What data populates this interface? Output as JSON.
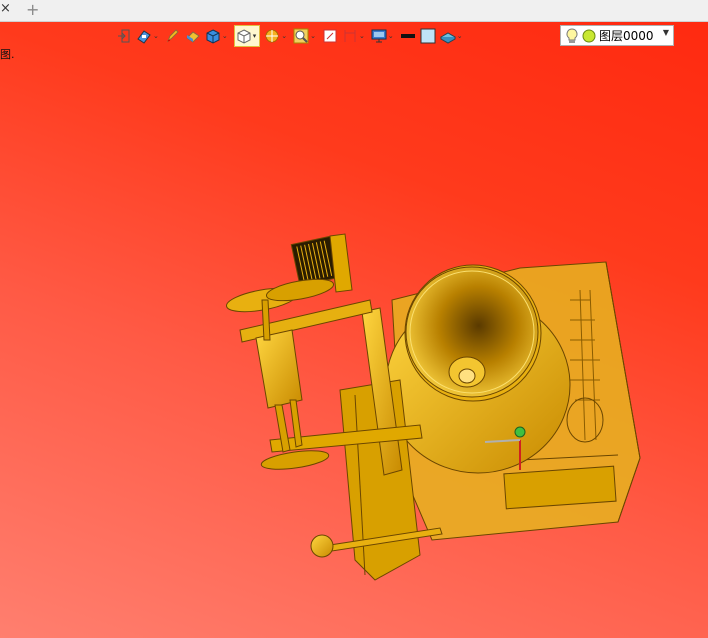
{
  "tabbar": {
    "close_glyph": "×",
    "add_glyph": "+"
  },
  "status_fragment": "图.",
  "toolbar": {
    "items": [
      {
        "icon": "exit-icon",
        "caret": false
      },
      {
        "icon": "view-orientation-icon",
        "caret": true
      },
      {
        "icon": "pen-icon",
        "caret": false
      },
      {
        "icon": "eraser-icon",
        "caret": false
      },
      {
        "icon": "solid-cube-icon",
        "caret": true
      },
      {
        "icon": "wireframe-cube-icon",
        "caret": true,
        "active": true
      },
      {
        "icon": "section-view-icon",
        "caret": true
      },
      {
        "icon": "zoom-icon",
        "caret": true
      },
      {
        "icon": "fit-view-icon",
        "caret": false
      },
      {
        "icon": "measure-icon",
        "caret": true
      },
      {
        "icon": "display-settings-icon",
        "caret": true
      },
      {
        "icon": "line-color-icon",
        "caret": false
      },
      {
        "icon": "fill-color-icon",
        "caret": false
      },
      {
        "icon": "material-icon",
        "caret": true
      }
    ],
    "colors": {
      "accent_yellow": "#e8b800",
      "blue": "#2e7bd6",
      "line_black": "#111111",
      "fill_light_blue": "#bfe3f7"
    }
  },
  "layer": {
    "label": "图层0000"
  },
  "viewport": {
    "background_top": "#ff2a10",
    "background_bottom": "#ff7f6f",
    "model_color": "#e8b000"
  }
}
